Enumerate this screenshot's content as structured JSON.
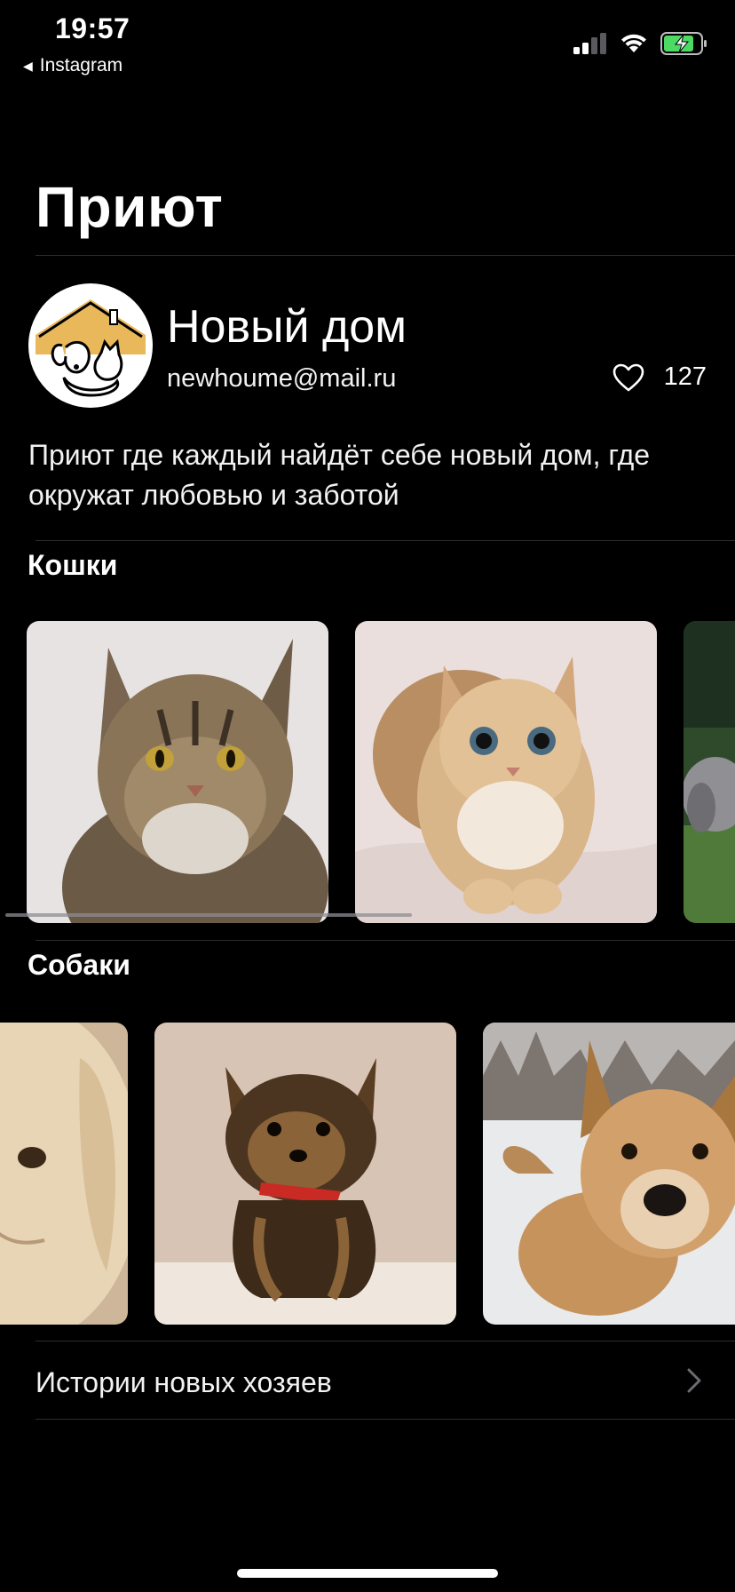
{
  "status_bar": {
    "time": "19:57",
    "back_app": "Instagram",
    "battery_state": "charging",
    "colors": {
      "battery_fill": "#4cd964"
    }
  },
  "page": {
    "title": "Приют"
  },
  "shelter": {
    "name": "Новый дом",
    "email": "newhoume@mail.ru",
    "likes": "127",
    "description": "Приют где каждый найдёт себе новый дом, где окружат любовью и заботой",
    "logo_colors": {
      "roof": "#e8b85a",
      "outline": "#000000"
    }
  },
  "sections": {
    "cats": {
      "title": "Кошки",
      "photos": [
        {
          "name": "tabby-cat-photo"
        },
        {
          "name": "ginger-cat-photo"
        },
        {
          "name": "grey-cat-on-grass-photo"
        }
      ]
    },
    "dogs": {
      "title": "Собаки",
      "photos": [
        {
          "name": "labrador-photo"
        },
        {
          "name": "yorkshire-terrier-photo"
        },
        {
          "name": "shepherd-dog-in-snow-photo"
        }
      ]
    }
  },
  "stories": {
    "label": "Истории новых хозяев"
  }
}
